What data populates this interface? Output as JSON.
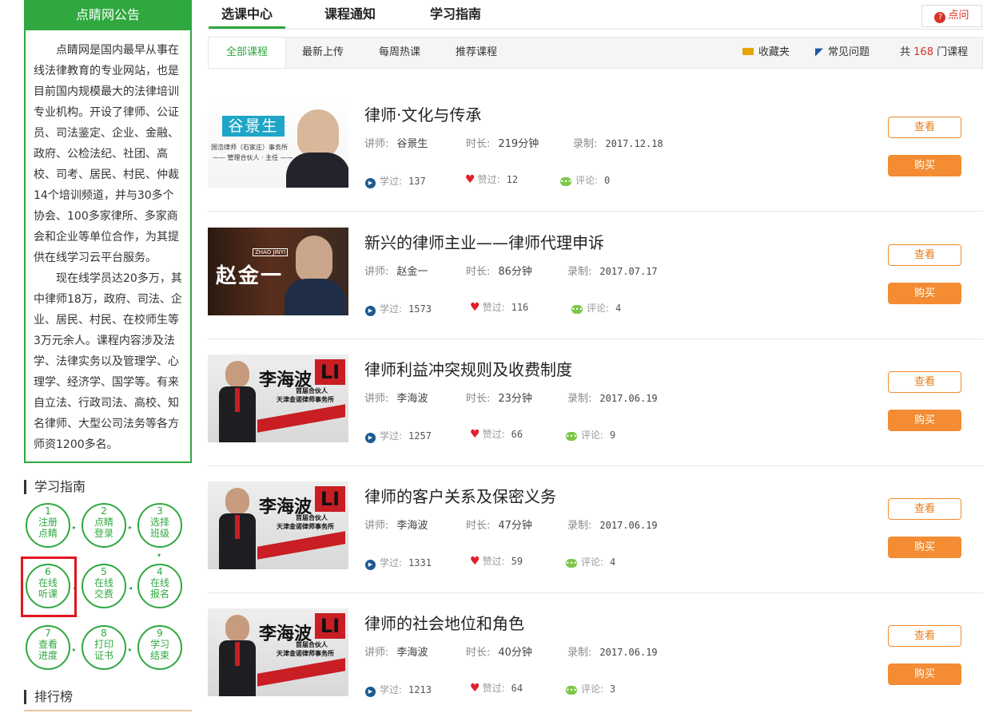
{
  "notice": {
    "title": "点睛网公告",
    "para1": "点睛网是国内最早从事在线法律教育的专业网站，也是目前国内规模最大的法律培训专业机构。开设了律师、公证员、司法鉴定、企业、金融、政府、公检法纪、社团、高校、司考、居民、村民、仲裁14个培训频道，并与30多个协会、100多家律所、多家商会和企业等单位合作，为其提供在线学习云平台服务。",
    "para2": "现在线学员达20多万，其中律师18万，政府、司法、企业、居民、村民、在校师生等3万元余人。课程内容涉及法学、法律实务以及管理学、心理学、经济学、国学等。有来自立法、行政司法、高校、知名律师、大型公司法务等各方师资1200多名。"
  },
  "guide": {
    "title": "学习指南",
    "steps": [
      {
        "num": "1",
        "line1": "注册",
        "line2": "点睛"
      },
      {
        "num": "2",
        "line1": "点睛",
        "line2": "登录"
      },
      {
        "num": "3",
        "line1": "选择",
        "line2": "班级"
      },
      {
        "num": "4",
        "line1": "在线",
        "line2": "报名"
      },
      {
        "num": "5",
        "line1": "在线",
        "line2": "交费"
      },
      {
        "num": "6",
        "line1": "在线",
        "line2": "听课"
      },
      {
        "num": "7",
        "line1": "查看",
        "line2": "进度"
      },
      {
        "num": "8",
        "line1": "打印",
        "line2": "证书"
      },
      {
        "num": "9",
        "line1": "学习",
        "line2": "结束"
      }
    ]
  },
  "ranking": {
    "title": "排行榜"
  },
  "tabs": {
    "main": [
      "选课中心",
      "课程通知",
      "学习指南"
    ],
    "help": "点问",
    "help_mark": "?"
  },
  "subtabs": [
    "全部课程",
    "最新上传",
    "每周热课",
    "推荐课程"
  ],
  "tools": {
    "favorites": "收藏夹",
    "faq": "常见问题",
    "count_prefix": "共",
    "count": "168",
    "count_suffix": "门课程"
  },
  "labels": {
    "teacher": "讲师:",
    "duration": "时长:",
    "recorded": "录制:",
    "studied": "学过:",
    "liked": "赞过:",
    "comments": "评论:",
    "view": "查看",
    "buy": "购买"
  },
  "courses": [
    {
      "title": "律师·文化与传承",
      "teacher": "谷景生",
      "duration": "219分钟",
      "date": "2017.12.18",
      "studied": "137",
      "liked": "12",
      "comments": "0",
      "thumb": {
        "name": "谷景生",
        "sub1": "国浩律师（石家庄）事务所",
        "sub2": "—— 管理合伙人 · 主任 ——"
      }
    },
    {
      "title": "新兴的律师主业——律师代理申诉",
      "teacher": "赵金一",
      "duration": "86分钟",
      "date": "2017.07.17",
      "studied": "1573",
      "liked": "116",
      "comments": "4",
      "thumb": {
        "name": "赵金一",
        "sub1": "ZHAO JINYI"
      }
    },
    {
      "title": "律师利益冲突规则及收费制度",
      "teacher": "李海波",
      "duration": "23分钟",
      "date": "2017.06.19",
      "studied": "1257",
      "liked": "66",
      "comments": "9",
      "thumb": {
        "name": "李海波",
        "sub1": "首届合伙人",
        "sub2": "天津金诺律师事务所"
      }
    },
    {
      "title": "律师的客户关系及保密义务",
      "teacher": "李海波",
      "duration": "47分钟",
      "date": "2017.06.19",
      "studied": "1331",
      "liked": "59",
      "comments": "4",
      "thumb": {
        "name": "李海波",
        "sub1": "首届合伙人",
        "sub2": "天津金诺律师事务所"
      }
    },
    {
      "title": "律师的社会地位和角色",
      "teacher": "李海波",
      "duration": "40分钟",
      "date": "2017.06.19",
      "studied": "1213",
      "liked": "64",
      "comments": "3",
      "thumb": {
        "name": "李海波",
        "sub1": "首届合伙人",
        "sub2": "天津金诺律师事务所"
      }
    }
  ],
  "colors": {
    "green": "#2fa83f",
    "orange": "#f38c33",
    "red": "#e0141e",
    "blue": "#1c5a8e"
  }
}
